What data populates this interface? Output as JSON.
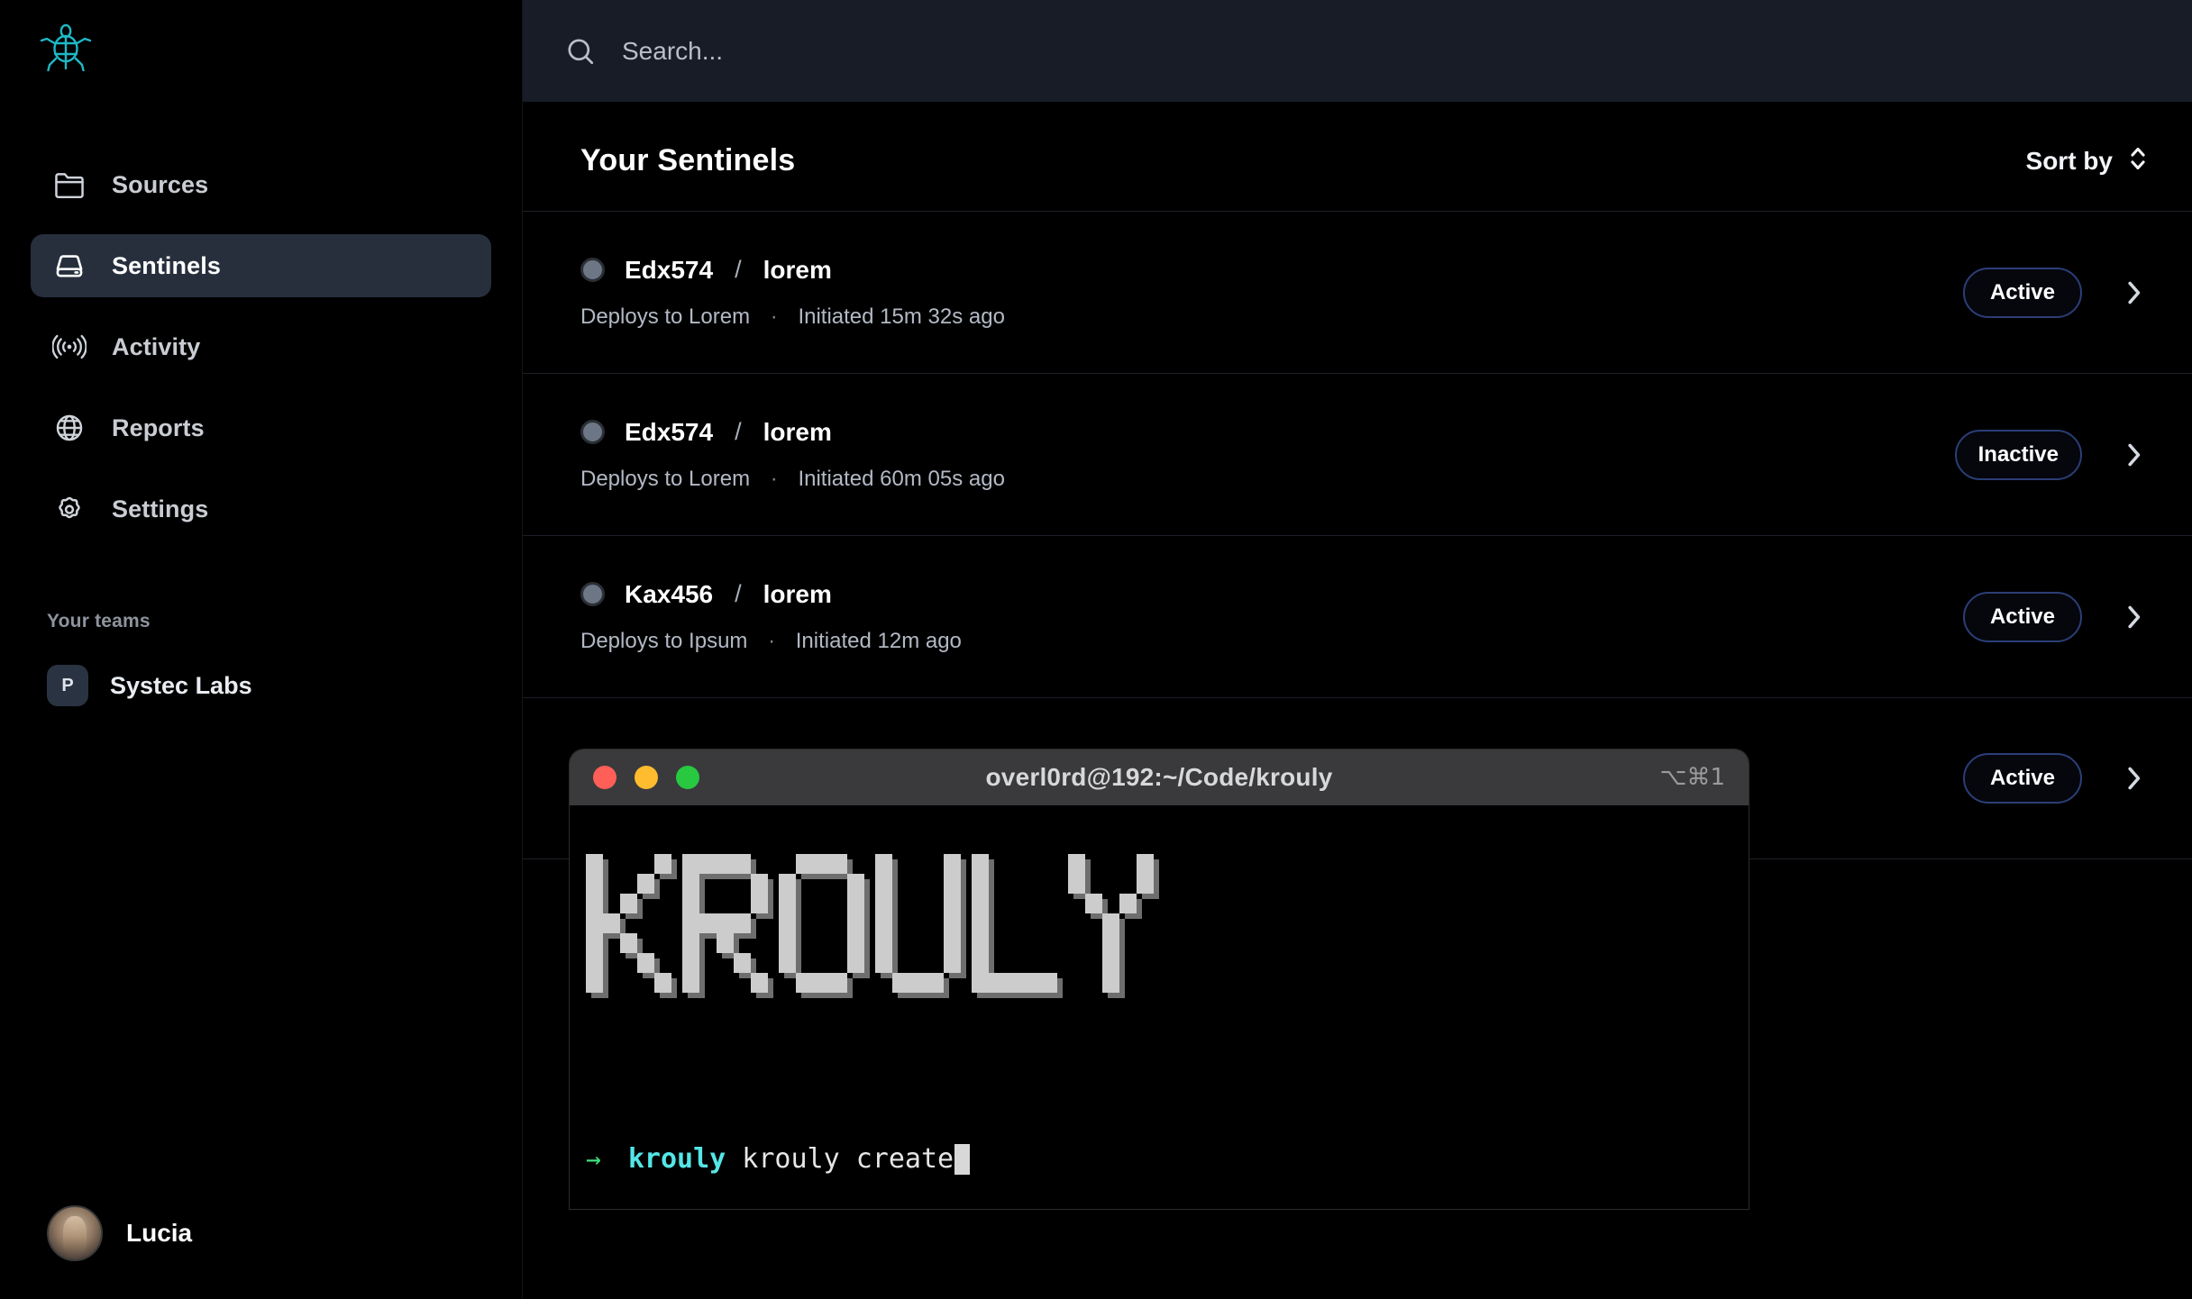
{
  "app": {
    "logo_icon": "turtle-logo-icon",
    "logo_color": "#1fb8c6",
    "accent_color": "#2b3e77",
    "background": "#000000",
    "sidebar_active_bg": "#272f3d"
  },
  "sidebar": {
    "items": [
      {
        "label": "Sources",
        "icon": "folder-icon",
        "active": false
      },
      {
        "label": "Sentinels",
        "icon": "server-icon",
        "active": true
      },
      {
        "label": "Activity",
        "icon": "signal-icon",
        "active": false
      },
      {
        "label": "Reports",
        "icon": "globe-icon",
        "active": false
      },
      {
        "label": "Settings",
        "icon": "gear-icon",
        "active": false
      }
    ],
    "teams_heading": "Your teams",
    "teams": [
      {
        "name": "Systec Labs",
        "initial": "P"
      }
    ],
    "user": {
      "name": "Lucia",
      "avatar": "user-photo-avatar"
    }
  },
  "search": {
    "placeholder": "Search...",
    "value": "",
    "icon": "search-icon"
  },
  "main": {
    "title": "Your Sentinels",
    "sort": {
      "label": "Sort by",
      "icon": "chevron-up-down-icon"
    },
    "sentinels": [
      {
        "status_dot": "status-dot",
        "name": "Edx574",
        "separator": "/",
        "branch": "lorem",
        "deploys_to": "Deploys to Lorem",
        "meta_sep": "·",
        "initiated": "Initiated 15m 32s ago",
        "badge": "Active",
        "chevron": "chevron-right-icon"
      },
      {
        "status_dot": "status-dot",
        "name": "Edx574",
        "separator": "/",
        "branch": "lorem",
        "deploys_to": "Deploys to Lorem",
        "meta_sep": "·",
        "initiated": "Initiated 60m 05s ago",
        "badge": "Inactive",
        "chevron": "chevron-right-icon"
      },
      {
        "status_dot": "status-dot",
        "name": "Kax456",
        "separator": "/",
        "branch": "lorem",
        "deploys_to": "Deploys to Ipsum",
        "meta_sep": "·",
        "initiated": "Initiated 12m ago",
        "badge": "Active",
        "chevron": "chevron-right-icon"
      },
      {
        "status_dot": "status-dot",
        "name": "",
        "separator": "",
        "branch": "",
        "deploys_to": "",
        "meta_sep": "",
        "initiated": "",
        "badge": "Active",
        "chevron": "chevron-right-icon"
      }
    ]
  },
  "terminal": {
    "title": "overl0rd@192:~/Code/krouly",
    "shortcut": "⌥⌘1",
    "traffic_lights": [
      "close-button",
      "minimize-button",
      "zoom-button"
    ],
    "ascii_banner": "KROULY",
    "prompt": {
      "arrow": "→",
      "cwd": "krouly",
      "command": "krouly create",
      "cursor": "block-cursor"
    }
  }
}
